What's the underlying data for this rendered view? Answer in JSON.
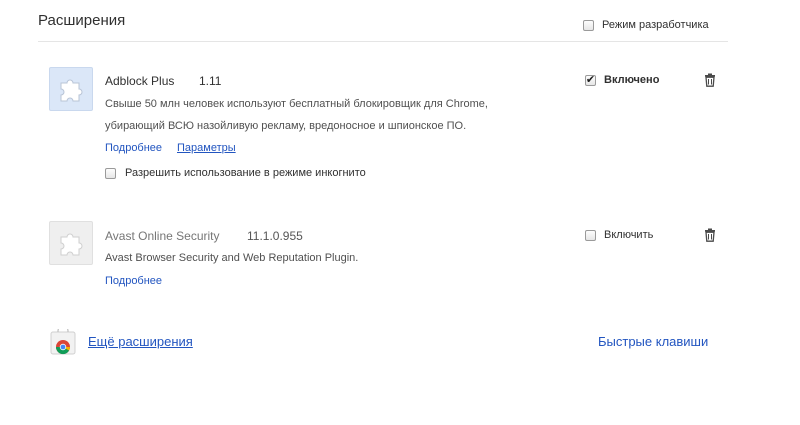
{
  "header": {
    "title": "Расширения",
    "developer_mode_label": "Режим разработчика",
    "developer_mode_checked": false
  },
  "extensions": [
    {
      "name": "Adblock Plus",
      "version": "1.11",
      "description_line1": "Свыше 50 млн человек используют бесплатный блокировщик для Chrome,",
      "description_line2": "убирающий ВСЮ назойливую рекламу, вредоносное и шпионское ПО.",
      "details_link": "Подробнее",
      "options_link": "Параметры",
      "incognito_label": "Разрешить использование в режиме инкогнито",
      "incognito_checked": false,
      "enabled": true,
      "enable_label": "Включено",
      "icon": "puzzle-icon"
    },
    {
      "name": "Avast Online Security",
      "version": "11.1.0.955",
      "description_line1": "Avast Browser Security and Web Reputation Plugin.",
      "details_link": "Подробнее",
      "enabled": false,
      "enable_label": "Включить",
      "icon": "puzzle-icon"
    }
  ],
  "footer": {
    "more_extensions_link": "Ещё расширения",
    "shortcuts_link": "Быстрые клавиши",
    "store_icon": "chrome-web-store-icon"
  },
  "colors": {
    "link": "#2255c0",
    "enabled_icon_bg": "#dbe7f8",
    "disabled_icon_bg": "#efefef"
  }
}
